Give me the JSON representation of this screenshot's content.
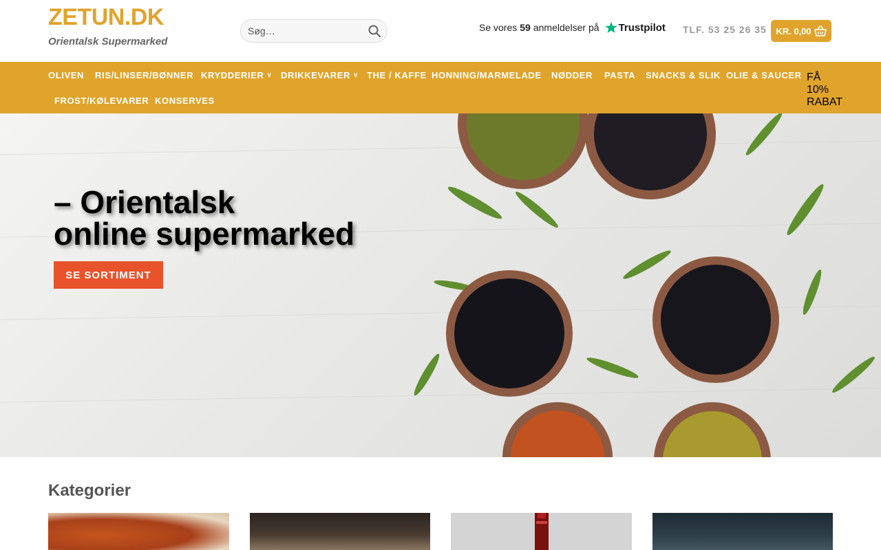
{
  "header": {
    "logo": "ZETUN.DK",
    "tagline": "Orientalsk Supermarked",
    "search_placeholder": "Søg…",
    "trust_prefix": "Se vores",
    "trust_count": "59",
    "trust_suffix": "anmeldelser på",
    "trust_brand": "Trustpilot",
    "phone": "TLF. 53 25 26 35",
    "cart_label": "KR. 0,00"
  },
  "nav": {
    "items": [
      {
        "label": "OLIVEN"
      },
      {
        "label": "RIS/LINSER/BØNNER"
      },
      {
        "label": "KRYDDERIER"
      },
      {
        "label": "DRIKKEVARER"
      },
      {
        "label": "THE / KAFFE"
      },
      {
        "label": "HONNING/MARMELADE"
      },
      {
        "label": "NØDDER"
      },
      {
        "label": "PASTA"
      },
      {
        "label": "SNACKS & SLIK"
      },
      {
        "label": "OLIE & SAUCER"
      },
      {
        "label": "FROST/KØLEVARER"
      },
      {
        "label": "KONSERVES"
      }
    ],
    "discount": [
      "FÅ",
      "10%",
      "RABAT"
    ]
  },
  "hero": {
    "line1": "– Orientalsk",
    "line2": "online supermarked",
    "cta": "SE SORTIMENT"
  },
  "categories": {
    "title": "Kategorier"
  },
  "colors": {
    "brand": "#e0a42c",
    "cta": "#e8532b"
  }
}
